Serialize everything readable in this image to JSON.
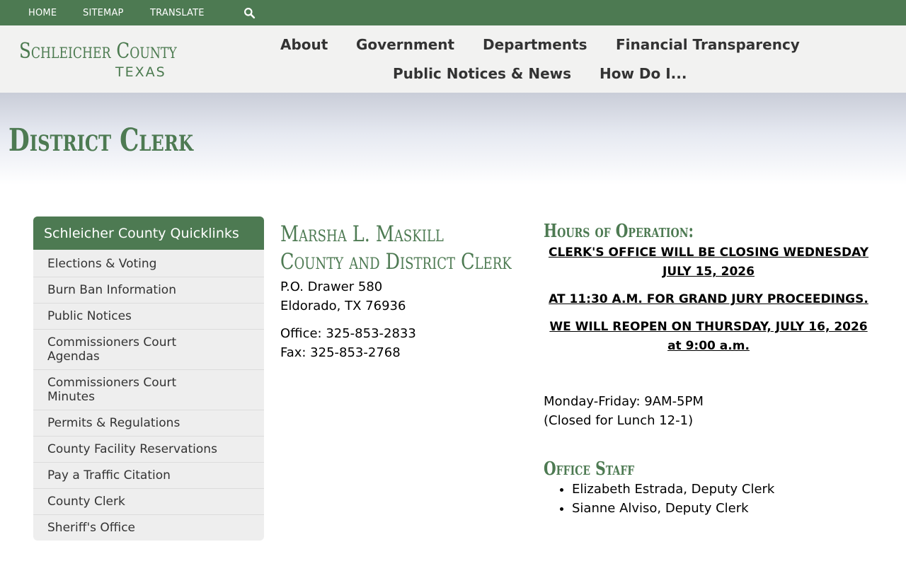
{
  "topbar": {
    "home": "HOME",
    "sitemap": "SITEMAP",
    "translate": "TRANSLATE",
    "search_icon": "search-icon"
  },
  "header": {
    "logo_line1": "Schleicher County",
    "logo_line2": "TEXAS",
    "nav": [
      "About",
      "Government",
      "Departments",
      "Financial Transparency",
      "Public Notices & News",
      "How Do I..."
    ]
  },
  "page": {
    "title": "District Clerk"
  },
  "sidebar": {
    "title": "Schleicher County Quicklinks",
    "items": [
      "Elections & Voting",
      "Burn Ban Information",
      "Public Notices",
      "Commissioners Court Agendas",
      "Commissioners Court Minutes",
      "Permits & Regulations",
      "County Facility Reservations",
      "Pay a Traffic Citation",
      "County Clerk",
      "Sheriff's Office"
    ]
  },
  "clerk": {
    "name": "Marsha L. Maskill",
    "role": "County and District Clerk",
    "address1": "P.O. Drawer 580",
    "address2": "Eldorado, TX 76936",
    "office": "Office: 325-853-2833",
    "fax": "Fax: 325-853-2768"
  },
  "hours": {
    "heading": "Hours of Operation:",
    "notice1": "CLERK'S OFFICE WILL BE CLOSING WEDNESDAY JULY 15, 2026",
    "notice2": "AT 11:30 A.M. FOR GRAND JURY PROCEEDINGS.",
    "notice3": "WE WILL REOPEN ON THURSDAY, JULY 16, 2026 at 9:00 a.m.",
    "days": "Monday-Friday: 9AM-5PM",
    "lunch": "(Closed for Lunch 12-1)"
  },
  "staff": {
    "heading": "Office Staff",
    "members": [
      "Elizabeth Estrada, Deputy Clerk",
      "Sianne Alviso, Deputy Clerk"
    ]
  },
  "colors": {
    "brand_green": "#4d7a52",
    "header_bg": "#f2f2f1",
    "sidebar_bg": "#eeeeee"
  }
}
